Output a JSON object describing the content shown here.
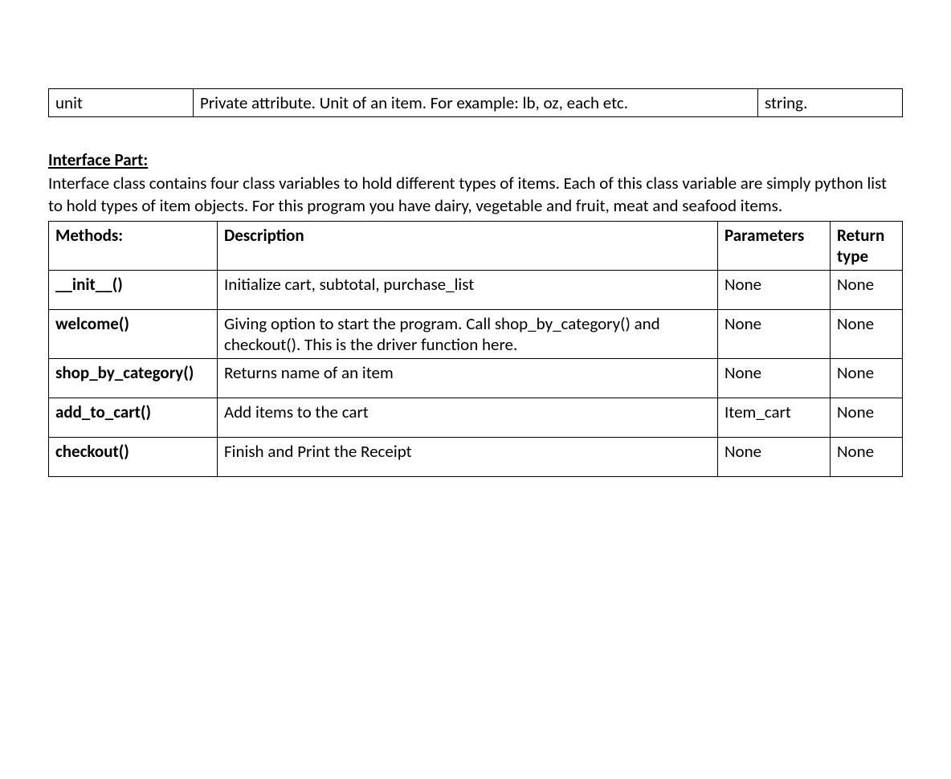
{
  "attribute_table": {
    "row": {
      "name": "unit",
      "description": "Private attribute. Unit of an item. For example: lb, oz, each etc.",
      "type": "string."
    }
  },
  "interface_section": {
    "heading": "Interface Part:",
    "intro": "Interface class contains four class variables to hold different types of items. Each of this class variable are simply python list to hold types of item objects. For this program you have dairy, vegetable and fruit, meat and seafood items."
  },
  "methods_table": {
    "headers": {
      "col1": "Methods:",
      "col2": "Description",
      "col3": "Parameters",
      "col4": "Return type"
    },
    "rows": [
      {
        "method": "__init__()",
        "description": "Initialize cart, subtotal, purchase_list",
        "parameters": "None",
        "return_type": "None"
      },
      {
        "method": "welcome()",
        "description": "Giving option to start the program. Call shop_by_category() and checkout(). This is the driver function here.",
        "parameters": "None",
        "return_type": "None"
      },
      {
        "method": "shop_by_category()",
        "description": "Returns name of an item",
        "parameters": "None",
        "return_type": "None"
      },
      {
        "method": "add_to_cart()",
        "description": "Add items to the cart",
        "parameters": "Item_cart",
        "return_type": "None"
      },
      {
        "method": "checkout()",
        "description": "Finish and Print the Receipt",
        "parameters": "None",
        "return_type": "None"
      }
    ]
  }
}
